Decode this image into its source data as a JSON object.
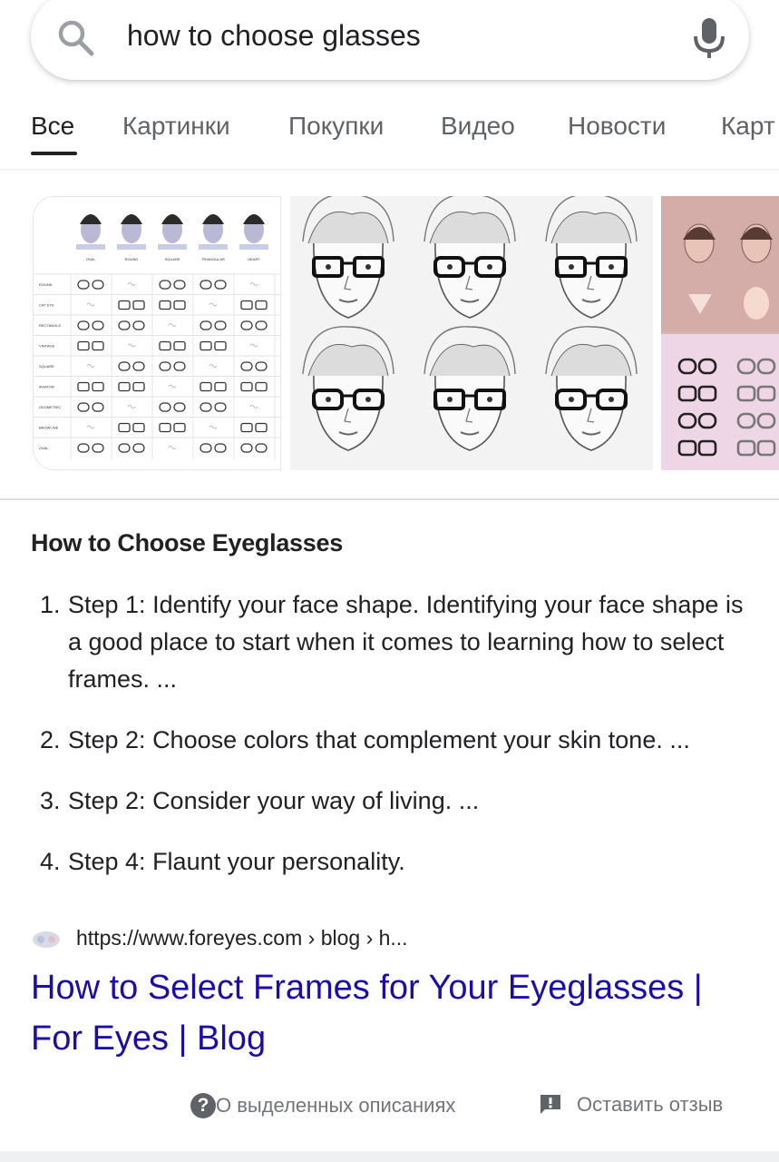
{
  "search": {
    "query": "how to choose glasses"
  },
  "tabs": [
    {
      "label": "Все",
      "active": true
    },
    {
      "label": "Картинки"
    },
    {
      "label": "Покупки"
    },
    {
      "label": "Видео"
    },
    {
      "label": "Новости"
    },
    {
      "label": "Карт"
    }
  ],
  "images": {
    "face_chart": {
      "columns": [
        "OVAL",
        "ROUND",
        "SQUARE",
        "TRIANGULAR",
        "HEART"
      ],
      "rows": [
        "ROUND",
        "CAT EYE",
        "RECTANGLE",
        "VINTAGE",
        "SQUARE",
        "AVIATOR",
        "GEOMETRIC",
        "BROWLINE",
        "OVAL"
      ]
    }
  },
  "snippet": {
    "title": "How to Choose Eyeglasses",
    "steps": [
      {
        "num": "1.",
        "text": "Step 1: Identify your face shape. Identifying your face shape is a good place to start when it comes to learning how to select frames. ..."
      },
      {
        "num": "2.",
        "text": "Step 2: Choose colors that complement your skin tone. ..."
      },
      {
        "num": "3.",
        "text": "Step 2: Consider your way of living. ..."
      },
      {
        "num": "4.",
        "text": "Step 4: Flaunt your personality."
      }
    ]
  },
  "result": {
    "url": "https://www.foreyes.com › blog › h...",
    "title": "How to Select Frames for Your Eyeglasses | For Eyes | Blog"
  },
  "footer": {
    "about_icon": "?",
    "about_label": "О выделенных описаниях",
    "feedback_label": "Оставить отзыв"
  },
  "colors": {
    "link": "#1a0dab",
    "text": "#202124",
    "secondary": "#5f6368"
  }
}
